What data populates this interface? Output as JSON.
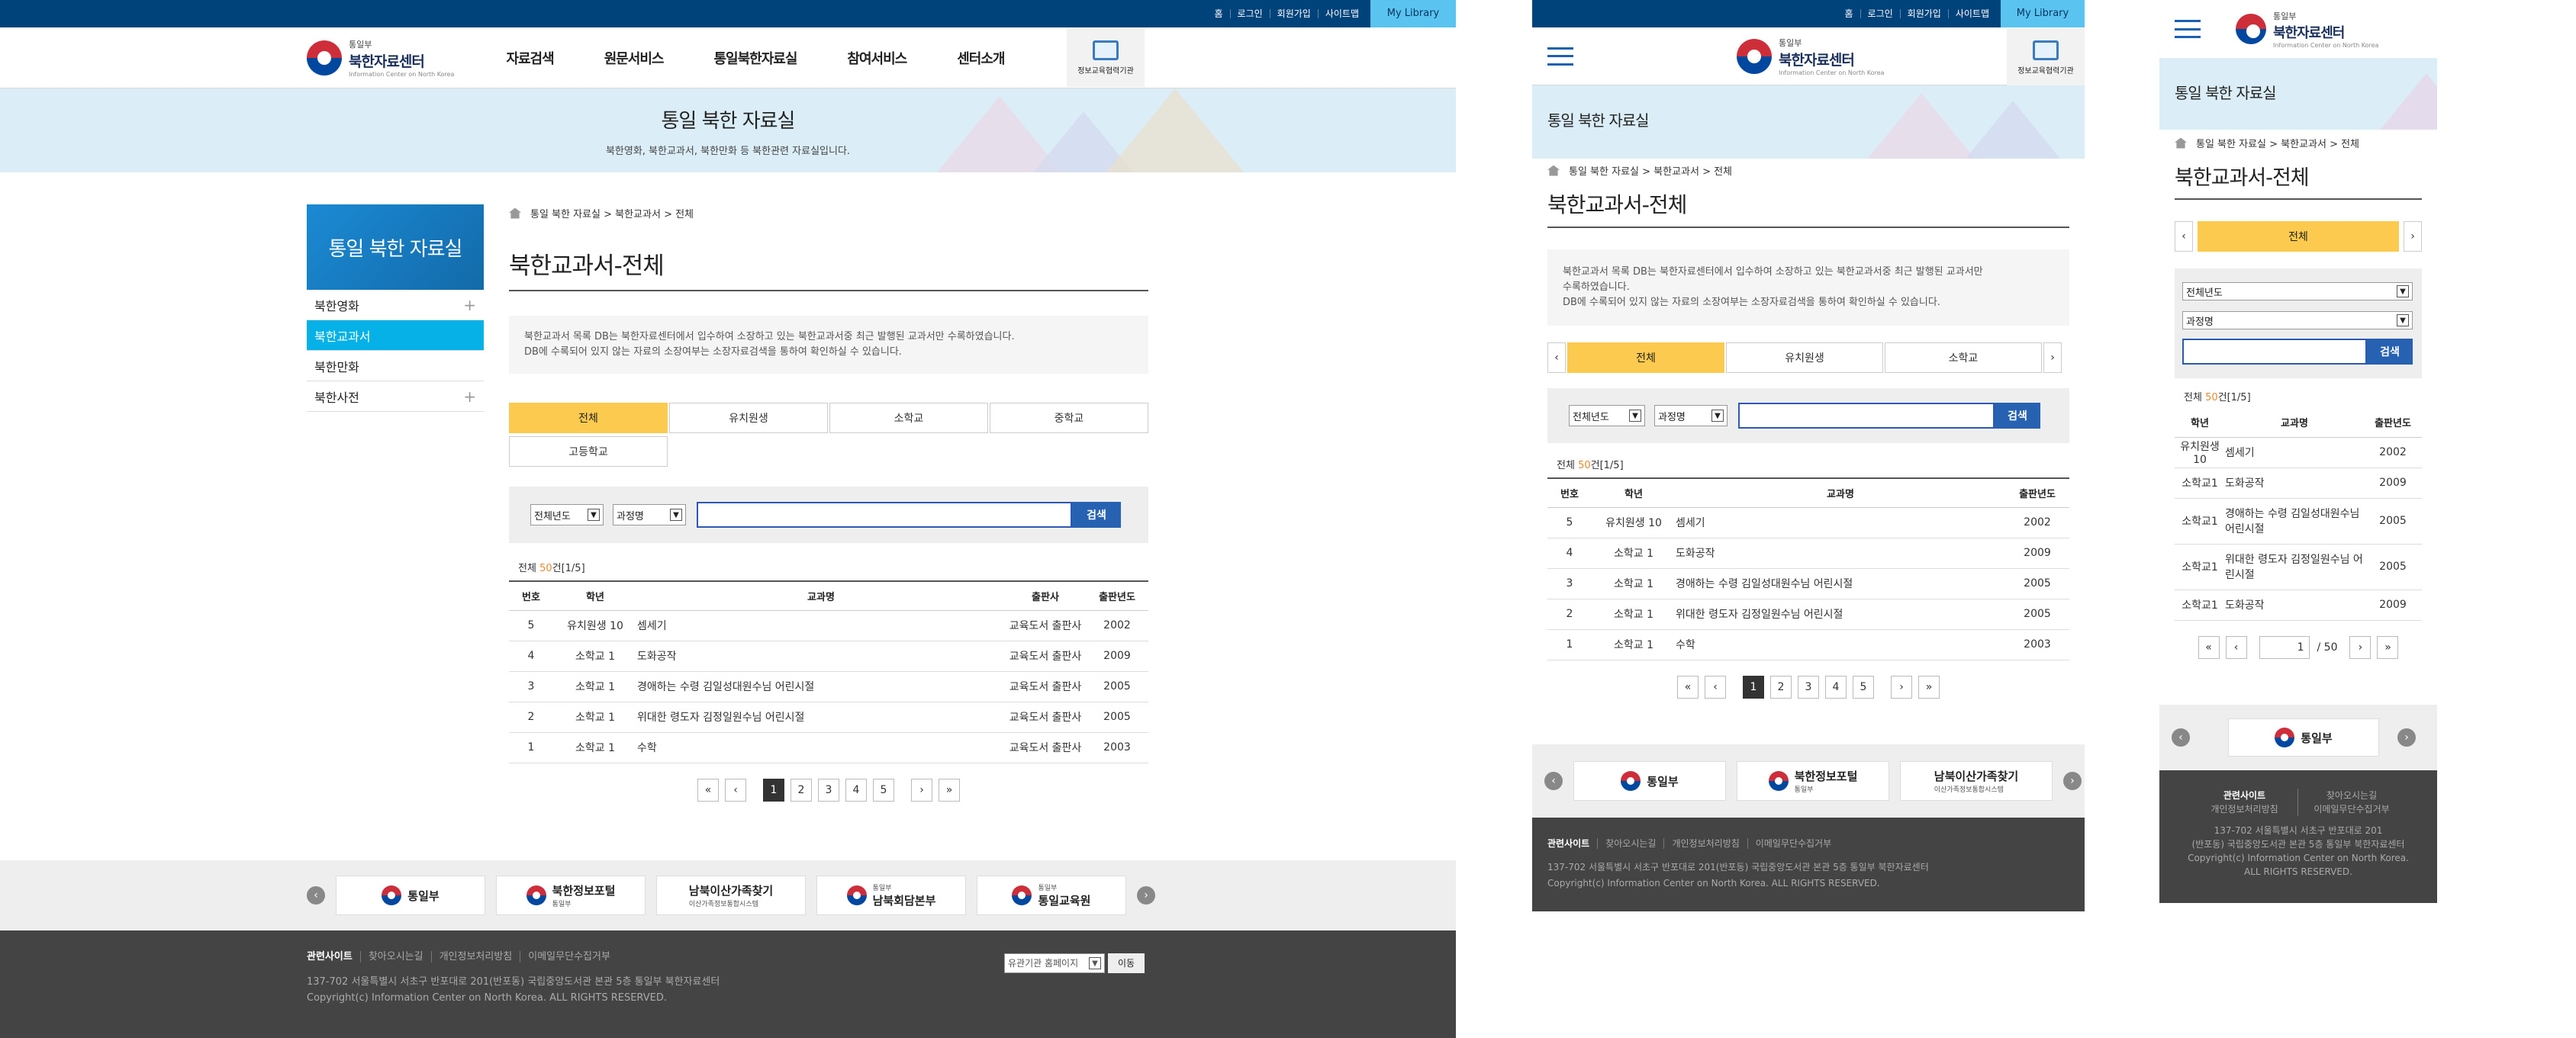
{
  "util": [
    "홈",
    "로그인",
    "회원가입",
    "사이트맵"
  ],
  "my_library": "My Library",
  "logo": {
    "small": "통일부",
    "name": "북한자료센터",
    "en": "Information Center on North Korea"
  },
  "gnb": [
    "자료검색",
    "원문서비스",
    "통일북한자료실",
    "참여서비스",
    "센터소개"
  ],
  "edu_label": "정보교육협력기관",
  "visual": {
    "title": "통일 북한 자료실",
    "desc": "북한영화, 북한교과서, 북한만화 등 북한관련 자료실입니다."
  },
  "lnb": {
    "title": "통일 북한 자료실",
    "items": [
      {
        "label": "북한영화",
        "toggle": "+"
      },
      {
        "label": "북한교과서",
        "toggle": ""
      },
      {
        "label": "북한만화",
        "toggle": ""
      },
      {
        "label": "북한사전",
        "toggle": "+"
      }
    ]
  },
  "breadcrumb": "통일 북한 자료실 > 북한교과서 > 전체",
  "page_title": "북한교과서-전체",
  "intro": {
    "desktop": [
      "북한교과서 목록 DB는 북한자료센터에서 입수하여 소장하고 있는 북한교과서중 최근 발행된 교과서만 수록하였습니다.",
      "DB에 수록되어 있지 않는 자료의 소장여부는 소장자료검색을 통하여 확인하실 수 있습니다."
    ],
    "tablet": [
      "북한교과서 목록 DB는 북한자료센터에서 입수하여 소장하고 있는 북한교과서중 최근 발행된 교과서만",
      "수록하였습니다.",
      "DB에 수록되어 있지 않는 자료의 소장여부는 소장자료검색을 통하여 확인하실 수 있습니다."
    ]
  },
  "tabs": [
    "전체",
    "유치원생",
    "소학교",
    "중학교",
    "고등학교"
  ],
  "search": {
    "year": "전체년도",
    "field": "과정명",
    "button": "검색",
    "value": ""
  },
  "total": {
    "prefix": "전체 ",
    "count": "50",
    "suffix": "건[1/5]"
  },
  "table": {
    "headers": [
      "번호",
      "학년",
      "교과명",
      "출판사",
      "출판년도"
    ],
    "rows": [
      {
        "no": "5",
        "grade": "유치원생 10",
        "title": "셈세기",
        "pub": "교육도서 출판사",
        "year": "2002"
      },
      {
        "no": "4",
        "grade": "소학교 1",
        "title": "도화공작",
        "pub": "교육도서 출판사",
        "year": "2009"
      },
      {
        "no": "3",
        "grade": "소학교 1",
        "title": "경애하는 수령 김일성대원수님 어린시절",
        "pub": "교육도서 출판사",
        "year": "2005"
      },
      {
        "no": "2",
        "grade": "소학교 1",
        "title": "위대한 령도자 김정일원수님 어린시절",
        "pub": "교육도서 출판사",
        "year": "2005"
      },
      {
        "no": "1",
        "grade": "소학교 1",
        "title": "수학",
        "pub": "교육도서 출판사",
        "year": "2003"
      }
    ]
  },
  "mobile_rows": [
    {
      "grade": "유치원생 10",
      "title": "셈세기",
      "year": "2002"
    },
    {
      "grade": "소학교1",
      "title": "도화공작",
      "year": "2009"
    },
    {
      "grade": "소학교1",
      "title": "경애하는 수령 김일성대원수님 어린시절",
      "year": "2005"
    },
    {
      "grade": "소학교1",
      "title": "위대한 령도자 김정일원수님 어린시절",
      "year": "2005"
    },
    {
      "grade": "소학교1",
      "title": "도화공작",
      "year": "2009"
    }
  ],
  "pager": {
    "first": "«",
    "prev": "‹",
    "pages": [
      "1",
      "2",
      "3",
      "4",
      "5"
    ],
    "next": "›",
    "last": "»",
    "mobile_current": "1",
    "mobile_total": "/ 50"
  },
  "banners": [
    {
      "name": "통일부",
      "sub": ""
    },
    {
      "name": "북한정보포털",
      "sub": "통일부"
    },
    {
      "name": "남북이산가족찾기",
      "sub": "이산가족정보통합시스템"
    },
    {
      "name": "남북회담본부",
      "sub": "통일부"
    },
    {
      "name": "통일교육원",
      "sub": "통일부"
    }
  ],
  "footer": {
    "links": [
      "관련사이트",
      "찾아오시는길",
      "개인정보처리방침",
      "이메일무단수집거부"
    ],
    "address": "137-702 서울특별시 서초구 반포대로 201(반포동) 국립중앙도서관 본관 5층 통일부 북한자료센터",
    "copyright": "Copyright(c) Information Center on North Korea. ALL RIGHTS RESERVED.",
    "family_select": "유관기관 홈페이지",
    "go": "이동",
    "mobile_address": [
      "137-702 서울특별시 서초구 반포대로 201",
      "(반포동) 국립중앙도서관 본관 5층 통일부 북한자료센터"
    ],
    "mobile_copyright": [
      "Copyright(c) Information Center on North Korea.",
      "ALL RIGHTS RESERVED."
    ]
  },
  "colors": {
    "navy": "#00437a",
    "sky": "#5bc3f0",
    "tab_active": "#fbca4f",
    "lnb_active": "#05b1e6",
    "search_btn": "#2762b2"
  }
}
